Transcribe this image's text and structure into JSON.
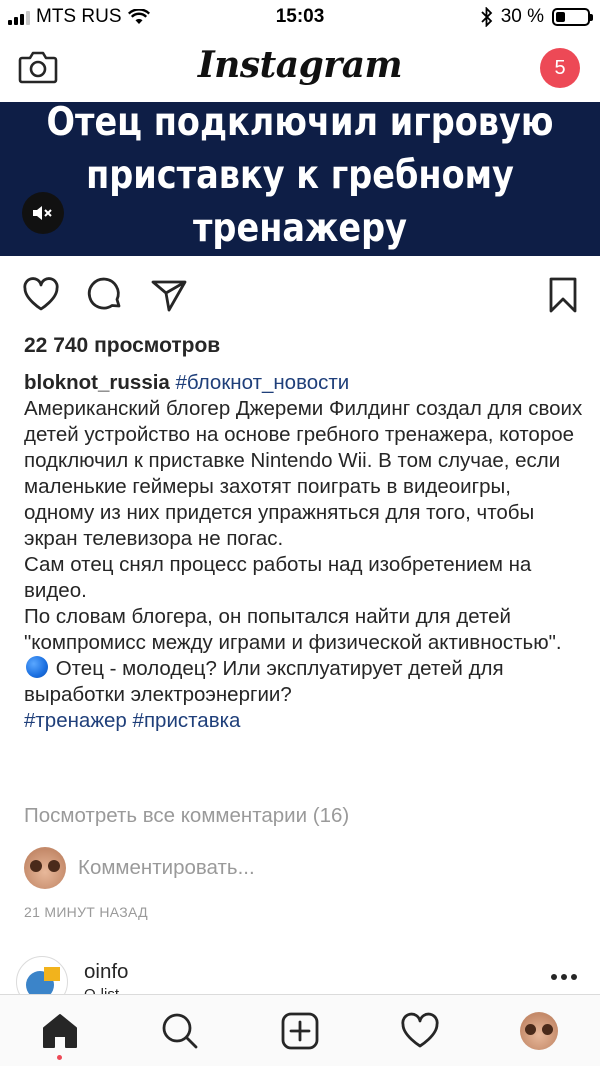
{
  "status_bar": {
    "carrier": "MTS RUS",
    "time": "15:03",
    "battery_text": "30 %",
    "battery_level": 0.3
  },
  "header": {
    "logo": "Instagram",
    "notification_count": "5",
    "icons": [
      "camera-icon"
    ]
  },
  "post": {
    "video_title": [
      "Отец подключил игровую",
      "приставку к гребному",
      "тренажеру"
    ],
    "mute_icon": "speaker-muted-icon",
    "views": "22 740 просмотров",
    "username": "bloknot_russia",
    "header_tag": "#блокнот_новости",
    "caption_line1": "Американский блогер Джереми Филдинг создал для своих детей устройство на основе гребного тренажера, которое подключил к приставке Nintendo Wii. В том случае, если маленькие геймеры захотят поиграть в видеоигры, одному из них придется упражняться для того, чтобы экран телевизора не погас.",
    "caption_line2": "Сам отец снял процесс работы над изобретением на видео.",
    "caption_line3_a": "По словам блогера, он попытался найти для детей \"компромисс между играми и физической активностью\".",
    "caption_line3_b": "Отец - молодец? Или эксплуатирует детей для выработки электроэнергии?",
    "tag1": "#тренажер",
    "tag2": "#приставка",
    "view_comments": "Посмотреть все комментарии (16)",
    "comment_placeholder": "Комментировать...",
    "timestamp": "21 МИНУТ НАЗАД"
  },
  "next_post": {
    "username": "oinfo",
    "subtitle": "O-list"
  },
  "tabbar": {
    "icons": [
      "home-icon",
      "search-icon",
      "add-post-icon",
      "activity-heart-icon",
      "profile-avatar"
    ]
  }
}
